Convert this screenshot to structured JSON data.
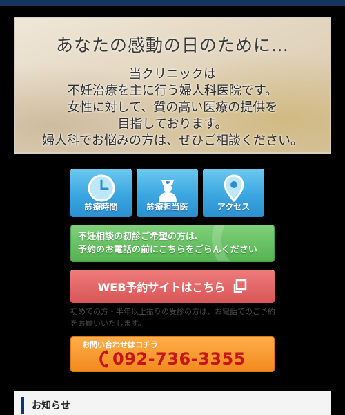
{
  "hero": {
    "title": "あなたの感動の日のために…",
    "lines": [
      "当クリニックは",
      "不妊治療を主に行う婦人科医院です。",
      "女性に対して、質の高い医療の提供を",
      "目指しております。",
      "婦人科でお悩みの方は、ぜひご相談ください。"
    ]
  },
  "nav": [
    {
      "label": "診療時間",
      "icon": "clock-icon"
    },
    {
      "label": "診療担当医",
      "icon": "nurse-icon"
    },
    {
      "label": "アクセス",
      "icon": "map-pin-icon"
    }
  ],
  "consult": {
    "line1": "不妊相談の初診ご希望の方は、",
    "line2": "予約のお電話の前にこちらをごらんください"
  },
  "web_reserve": {
    "label": "WEB予約サイトはこちら",
    "icon": "external-link-icon"
  },
  "note": "初めての方・半年以上振りの受診の方は、お電話でのご予約をお願いいたします。",
  "tel": {
    "caption": "お問い合わせはコチラ",
    "number": "092-736-3355",
    "icon": "phone-icon"
  },
  "news": {
    "title": "お知らせ"
  },
  "colors": {
    "navy": "#16355e",
    "blue": "#3aa6e0",
    "green": "#54b350",
    "red": "#d85656",
    "orange": "#f28a1d",
    "tel_red": "#c4161c"
  }
}
